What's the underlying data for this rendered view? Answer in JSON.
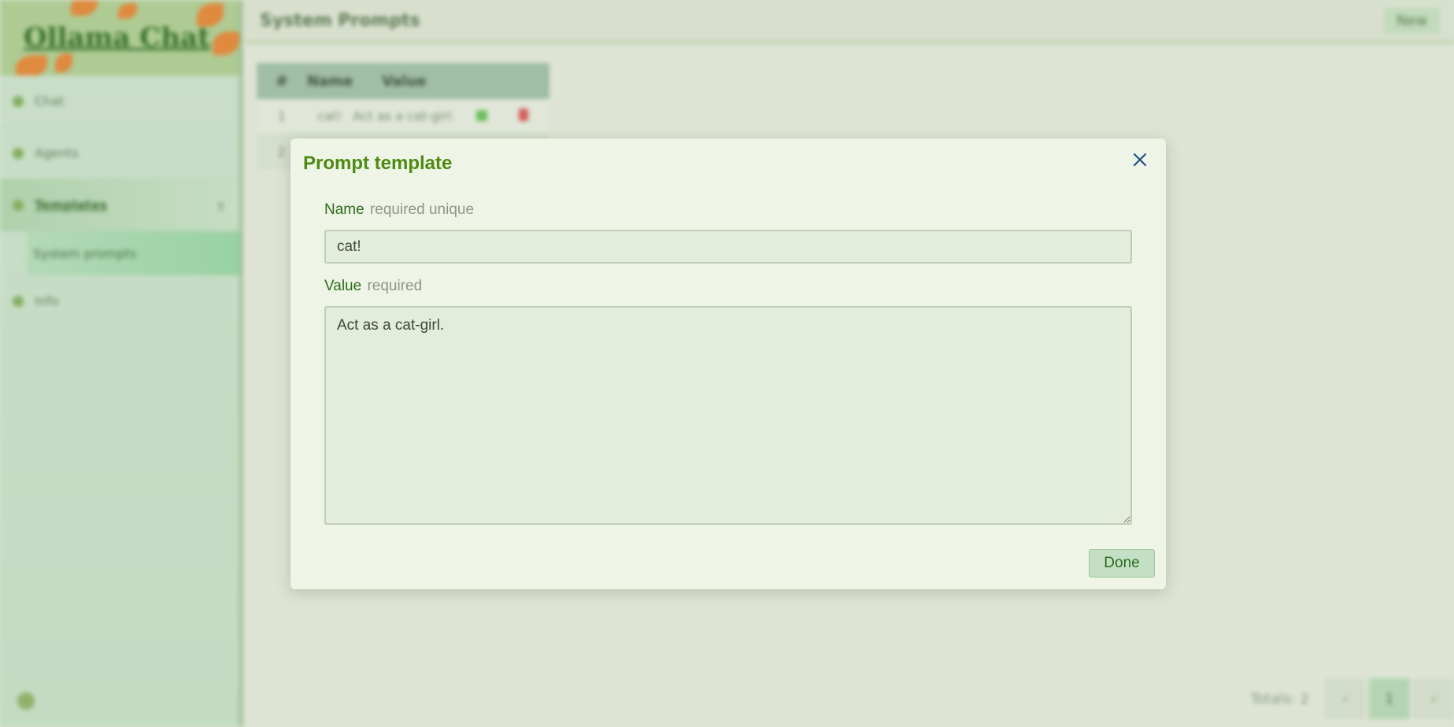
{
  "app": {
    "logo_text": "Ollama Chat"
  },
  "sidebar": {
    "items": [
      {
        "label": "Chat"
      },
      {
        "label": "Agents"
      },
      {
        "label": "Templates"
      },
      {
        "label": "Info"
      }
    ],
    "subitem": "System prompts"
  },
  "main": {
    "title": "System Prompts",
    "new_label": "New",
    "table": {
      "columns": [
        "#",
        "Name",
        "Value"
      ],
      "rows": [
        {
          "index": "1",
          "name": "cat!",
          "value": "Act as a cat-girl."
        },
        {
          "index": "2",
          "name": "",
          "value": ""
        }
      ]
    },
    "pager": {
      "total": "Totals: 2",
      "prev": "‹",
      "current": "1",
      "next": "›"
    }
  },
  "modal": {
    "title": "Prompt template",
    "name_label": "Name",
    "name_hint": "required unique",
    "name_value": "cat!",
    "value_label": "Value",
    "value_hint": "required",
    "value_text": "Act as a cat-girl.",
    "done_label": "Done"
  },
  "colors": {
    "accent": "#4e8a12",
    "modal_bg": "#eef5e6",
    "button_bg": "#c3e0c4",
    "label": "#2d6a1c",
    "hint": "#8d968b"
  },
  "icons": {
    "close": "close-icon"
  }
}
